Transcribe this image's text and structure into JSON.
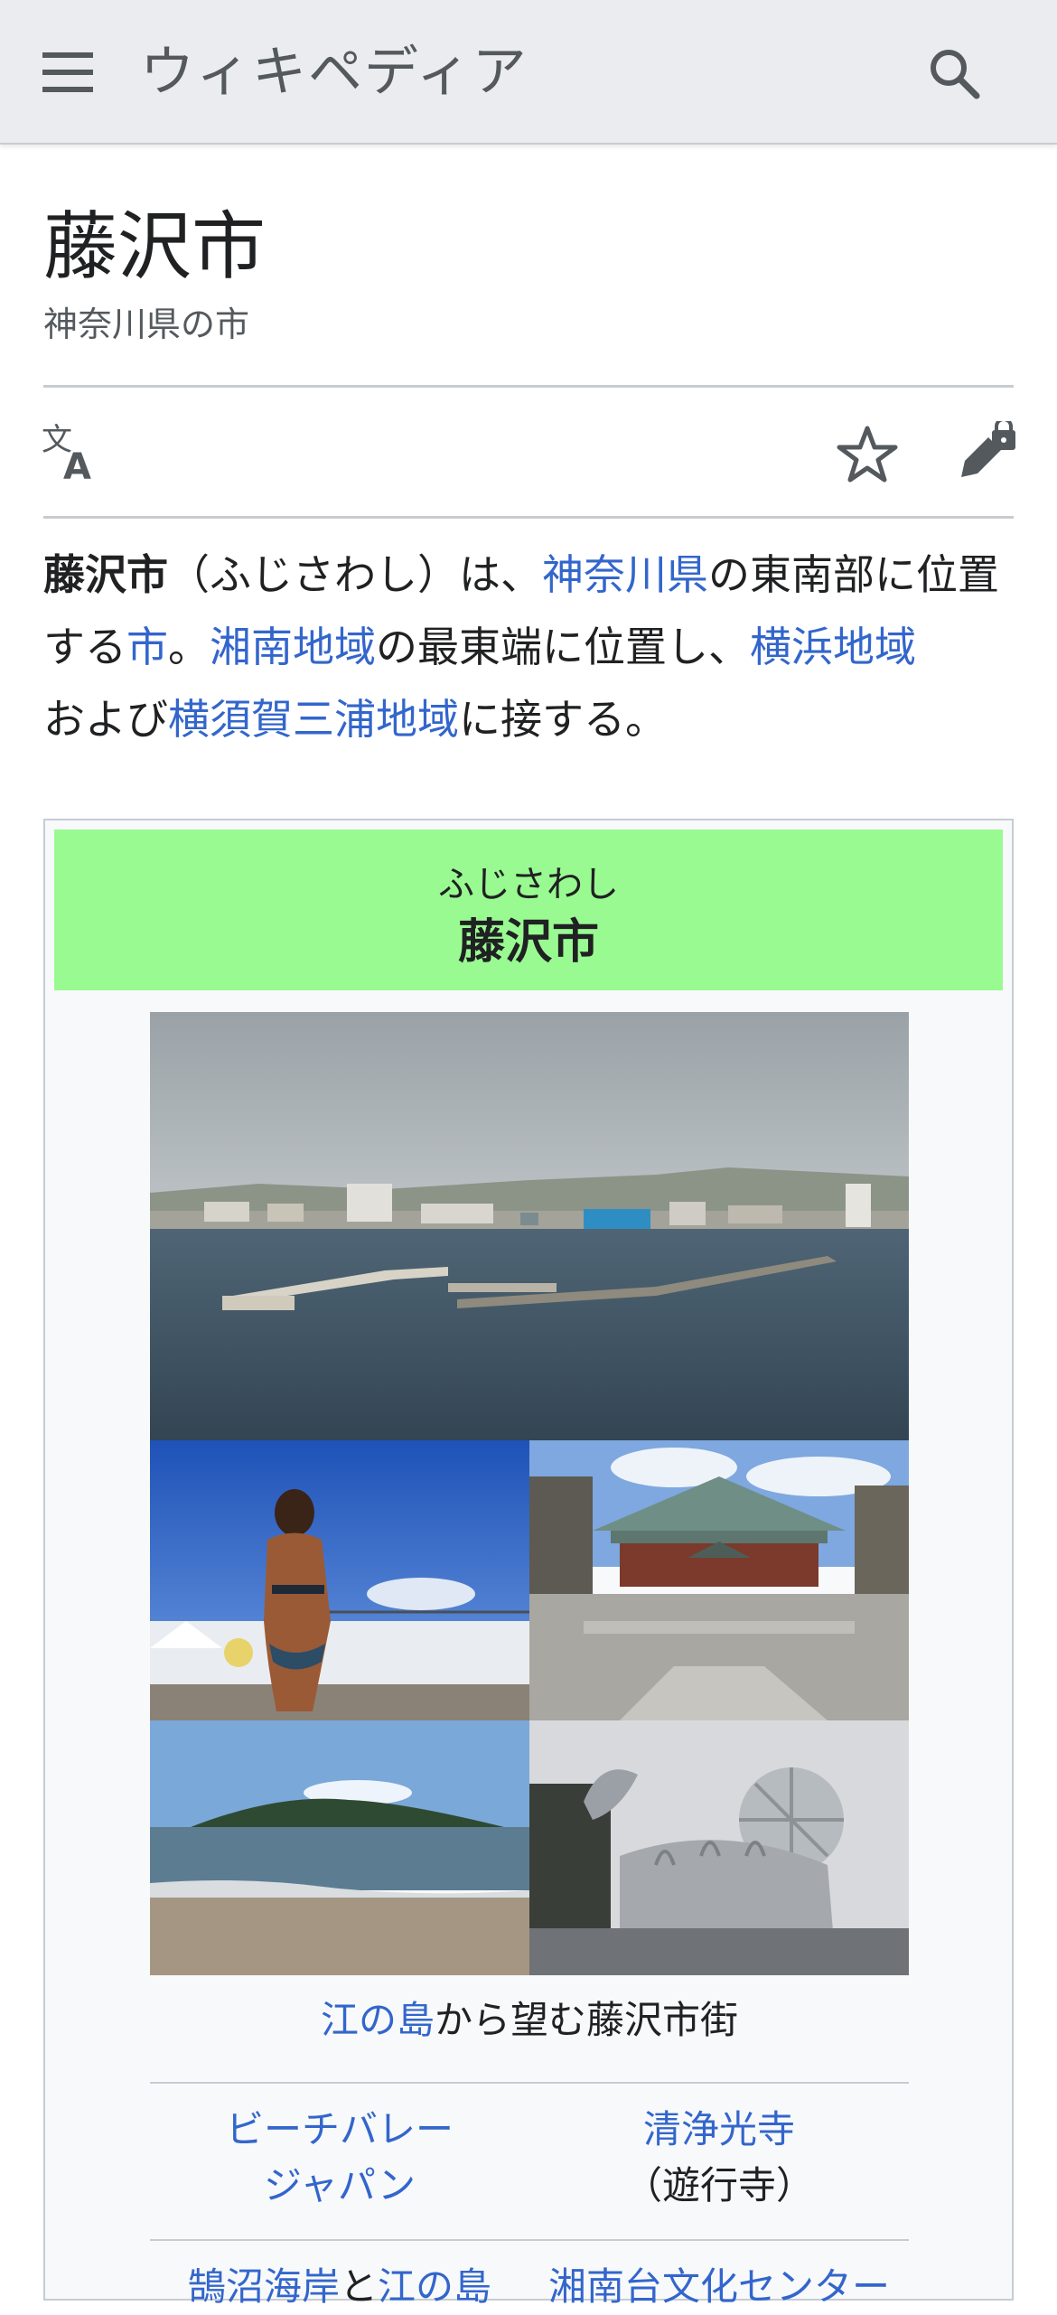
{
  "header": {
    "site_title": "ウィキペディア",
    "menu_icon": "hamburger-menu-icon",
    "search_icon": "search-icon"
  },
  "article": {
    "title": "藤沢市",
    "subtitle": "神奈川県の市",
    "actions": {
      "language_icon": "language-icon",
      "watch_icon": "star-icon",
      "edit_icon": "edit-locked-icon"
    },
    "lead": {
      "bold": "藤沢市",
      "t1": "（ふじさわし）は、",
      "link1": "神奈川県",
      "t2": "の東南部に位置する",
      "link2": "市",
      "t3": "。",
      "link3": "湘南地域",
      "t4": "の最東端に位置し、",
      "link4": "横浜地域",
      "t5": "および",
      "link5": "横須賀三浦地域",
      "t6": "に接する。"
    }
  },
  "infobox": {
    "reading": "ふじさわし",
    "name": "藤沢市",
    "header_color": "#99fa91",
    "caption_main": {
      "link": "江の島",
      "text": "から望む藤沢市街"
    },
    "captions": {
      "beach_volley": "ビーチバレージャパン",
      "temple_name": "清浄光寺",
      "temple_alias": "（遊行寺）",
      "coast_link1": "鵠沼海岸",
      "coast_and": "と",
      "coast_link2": "江の島",
      "culture_center": "湘南台文化センター"
    }
  },
  "colors": {
    "link": "#3366cc",
    "header_bg": "#eaecf0",
    "text": "#202122",
    "muted": "#54595d"
  }
}
